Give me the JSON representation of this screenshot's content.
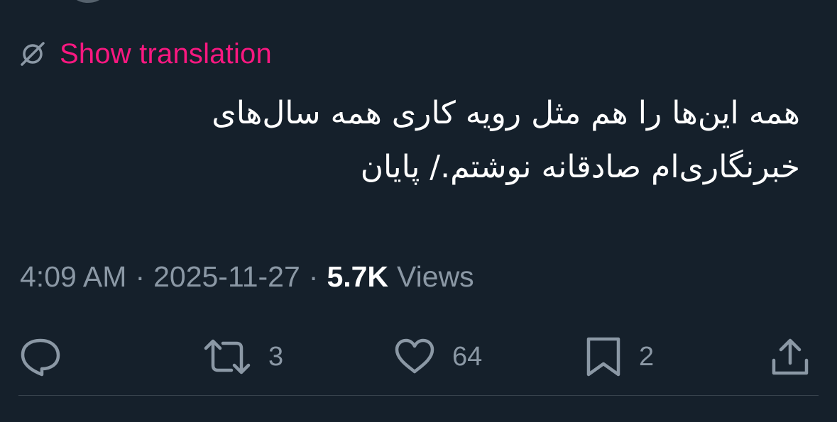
{
  "translation": {
    "label": "Show translation"
  },
  "tweet": {
    "line1": "همه این‌ها را هم مثل رویه کاری همه سال‌های",
    "line2": "خبرنگاری‌ام صادقانه نوشتم./ پایان"
  },
  "meta": {
    "time": "4:09 AM",
    "separator": "·",
    "date": "2025-11-27",
    "views_count": "5.7K",
    "views_label": "Views"
  },
  "actions": {
    "reply_count": "",
    "retweet_count": "3",
    "like_count": "64",
    "bookmark_count": "2"
  },
  "colors": {
    "background": "#15202b",
    "accent": "#f91880",
    "muted": "#8b98a5",
    "text": "#ffffff"
  },
  "icons": {
    "translate": "translate-icon",
    "reply": "reply-icon",
    "retweet": "retweet-icon",
    "like": "heart-icon",
    "bookmark": "bookmark-icon",
    "share": "share-icon"
  }
}
